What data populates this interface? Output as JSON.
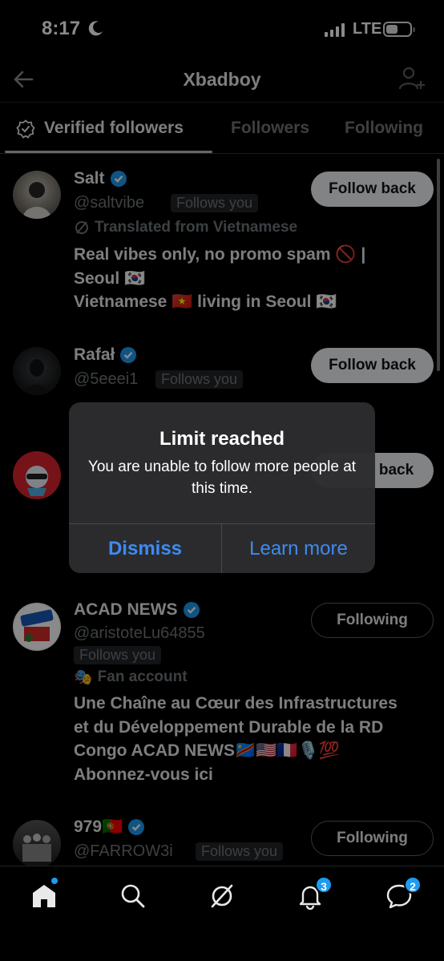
{
  "status_bar": {
    "time": "8:17",
    "network": "LTE"
  },
  "header": {
    "title": "Xbadboy"
  },
  "tabs": [
    {
      "label": "Verified followers"
    },
    {
      "label": "Followers"
    },
    {
      "label": "Following"
    }
  ],
  "users": [
    {
      "name": "Salt",
      "handle": "@saltvibe",
      "badge": "Follows you",
      "meta": "Translated from Vietnamese",
      "bio": [
        "Real vibes only, no promo spam 🚫 |",
        "Seoul 🇰🇷",
        "Vietnamese 🇻🇳 living in Seoul 🇰🇷"
      ],
      "button": "Follow back"
    },
    {
      "name": "Rafał",
      "handle": "@5eeei1",
      "badge": "Follows you",
      "button": "Follow back"
    },
    {
      "button_partial": "back"
    },
    {
      "name": "ACAD NEWS",
      "handle": "@aristoteLu64855",
      "badge": "Follows you",
      "meta": "Fan account",
      "bio": [
        "Une Chaîne au Cœur des Infrastructures",
        "et du Développement Durable de la RD",
        "Congo ACAD NEWS🇨🇩🇺🇸🇫🇷🎙️💯",
        "Abonnez-vous ici"
      ],
      "button": "Following"
    },
    {
      "name": "979🇵🇹",
      "handle": "@FARROW3i",
      "badge": "Follows you",
      "button": "Following"
    }
  ],
  "alert": {
    "title": "Limit reached",
    "message": "You are unable to follow more people at this time.",
    "dismiss": "Dismiss",
    "learn_more": "Learn more"
  },
  "bottom_nav": {
    "notifications_count": "3",
    "messages_count": "2"
  },
  "colors": {
    "accent": "#1d9bf0",
    "alert_button": "#3d8bf2"
  }
}
